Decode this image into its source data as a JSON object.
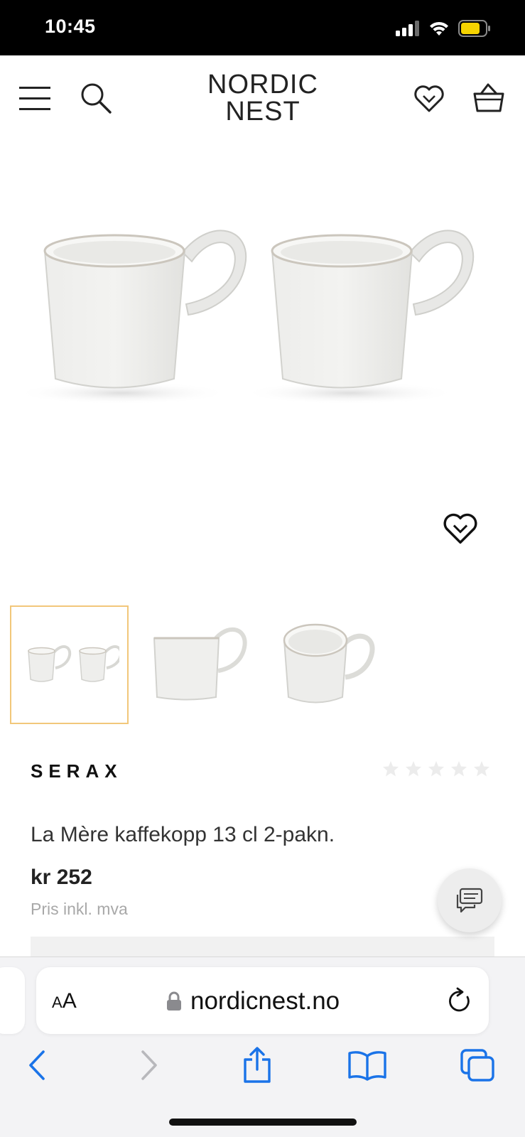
{
  "status_bar": {
    "time": "10:45"
  },
  "header": {
    "logo_line1": "NORDIC",
    "logo_line2": "NEST",
    "icons": [
      "menu-icon",
      "search-icon",
      "heart-icon",
      "basket-icon"
    ]
  },
  "product": {
    "brand": "SERAX",
    "rating_stars": 0,
    "rating_max": 5,
    "title": "La Mère kaffekopp 13 cl 2-pakn.",
    "price": "kr 252",
    "vat_note": "Pris inkl. mva"
  },
  "thumbnails": [
    {
      "name": "two-mugs",
      "selected": true
    },
    {
      "name": "mug-side",
      "selected": false
    },
    {
      "name": "mug-top",
      "selected": false
    }
  ],
  "colors": {
    "accent_selected": "#f2c77a",
    "ios_blue": "#1a73e8"
  },
  "safari": {
    "aa_big": "A",
    "aa_small": "A",
    "url": "nordicnest.no"
  }
}
